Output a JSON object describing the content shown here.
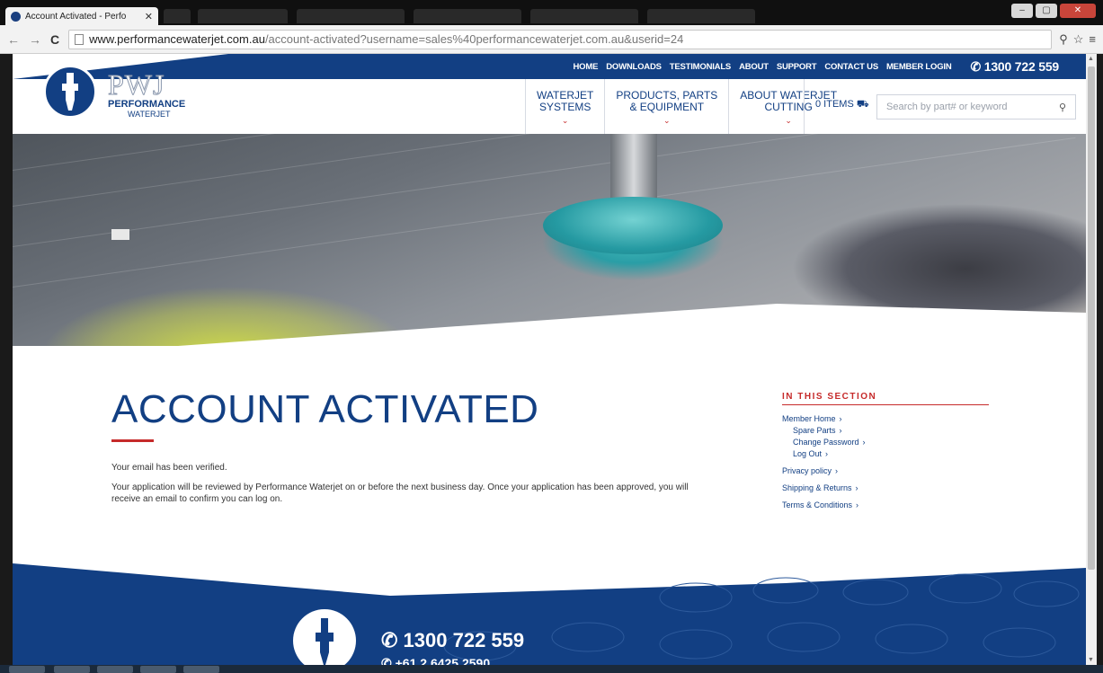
{
  "browser": {
    "tab_title": "Account Activated - Perfo",
    "tab_close": "✕",
    "url_host": "www.performancewaterjet.com.au",
    "url_path": "/account-activated?username=sales%40performancewaterjet.com.au&userid=24",
    "back": "←",
    "forward": "→",
    "reload": "C",
    "zoom_icon": "⚲",
    "star_icon": "☆",
    "menu_icon": "≡",
    "win_min": "–",
    "win_max": "▢",
    "win_close": "✕"
  },
  "site": {
    "brand_color": "#123f83",
    "accent_color": "#c62a2a",
    "logo": {
      "mark": "PWJ",
      "line1": "PERFORMANCE",
      "line2": "WATERJET"
    },
    "topnav": [
      "HOME",
      "DOWNLOADS",
      "TESTIMONIALS",
      "ABOUT",
      "SUPPORT",
      "CONTACT US",
      "MEMBER LOGIN"
    ],
    "phone": "1300 722 559",
    "mainnav": [
      {
        "line1": "WATERJET",
        "line2": "SYSTEMS"
      },
      {
        "line1": "PRODUCTS, PARTS",
        "line2": "& EQUIPMENT"
      },
      {
        "line1": "ABOUT WATERJET",
        "line2": "CUTTING"
      }
    ],
    "cart": "0 ITEMS",
    "search_placeholder": "Search by part# or keyword"
  },
  "content": {
    "title": "ACCOUNT ACTIVATED",
    "paragraphs": [
      "Your email has been verified.",
      "Your application will be reviewed by Performance Waterjet on or before the next business day. Once your application has been approved, you will receive an email to confirm you can log on."
    ]
  },
  "sidebar": {
    "heading": "IN THIS SECTION",
    "items": [
      {
        "label": "Member Home",
        "level": 0
      },
      {
        "label": "Spare Parts",
        "level": 1
      },
      {
        "label": "Change Password",
        "level": 1
      },
      {
        "label": "Log Out",
        "level": 1
      },
      {
        "label": "Privacy policy",
        "level": 0
      },
      {
        "label": "Shipping & Returns",
        "level": 0
      },
      {
        "label": "Terms & Conditions",
        "level": 0
      }
    ]
  },
  "footer": {
    "phone": "1300 722 559",
    "phone_intl": "+61 2 6425 2590"
  }
}
